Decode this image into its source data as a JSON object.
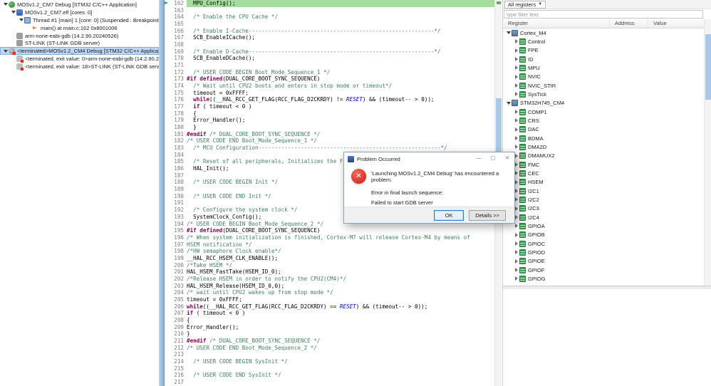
{
  "colors": {
    "debug_current_line_bg": "#a5dd9e",
    "selection_blue": "#bcd8f4",
    "error_red": "#d93025",
    "comment_green": "#3f7f5f",
    "keyword_purple": "#7f0055",
    "enum_blue": "#0000c0",
    "left_strip_blue": "#84abd8",
    "scrollbar_thumb_blue": "#a9c9e8"
  },
  "glyphs": {
    "error": "✕",
    "minimize": "—",
    "maximize": "▢",
    "close": "✕",
    "dropdown": "▼"
  },
  "debug_view": {
    "items": [
      {
        "label": "MOSv1.2_CM7 Debug [STM32 C/C++ Application]",
        "indent": 0,
        "expander": "expanded",
        "icon": "debug-launch-icon",
        "selected": false
      },
      {
        "label": "MOSv1.2_CM7.elf [cores: 0]",
        "indent": 1,
        "expander": "expanded",
        "icon": "executable-icon",
        "selected": false
      },
      {
        "label": "Thread #1 [main] 1 [core: 0] (Suspended : Breakpoint)",
        "indent": 2,
        "expander": "expanded",
        "icon": "thread-icon",
        "selected": false
      },
      {
        "label": "main() at main.c:162 0x8001006",
        "indent": 3,
        "expander": "none",
        "icon": "stack-frame-icon",
        "selected": false
      },
      {
        "label": "arm-none-eabi-gdb (14.2.90.20240526)",
        "indent": 1,
        "expander": "none",
        "icon": "process-icon",
        "selected": false
      },
      {
        "label": "ST-LINK (ST-LINK GDB server)",
        "indent": 1,
        "expander": "none",
        "icon": "process-icon",
        "selected": false
      },
      {
        "label": "<terminated>MOSv1.2_CM4 Debug [STM32 C/C++ Applica",
        "indent": 0,
        "expander": "expanded",
        "icon": "debug-launch-terminated-icon",
        "selected": true
      },
      {
        "label": "<terminated, exit value: 0>arm-none-eabi-gdb (14.2.90.2",
        "indent": 1,
        "expander": "none",
        "icon": "process-terminated-icon",
        "selected": false
      },
      {
        "label": "<terminated, exit value: 18>ST-LINK (ST-LINK GDB server)",
        "indent": 1,
        "expander": "none",
        "icon": "process-terminated-icon",
        "selected": false
      }
    ]
  },
  "editor": {
    "current_line": 162,
    "lines": [
      {
        "n": 162,
        "t": "  MPU_Config();"
      },
      {
        "n": 163,
        "t": ""
      },
      {
        "n": 164,
        "t": "  /* Enable the CPU Cache */"
      },
      {
        "n": 165,
        "t": ""
      },
      {
        "n": 166,
        "t": "  /* Enable I-Cache---------------------------------------------------------*/"
      },
      {
        "n": 167,
        "t": "  SCB_EnableICache();"
      },
      {
        "n": 168,
        "t": ""
      },
      {
        "n": 169,
        "t": "  /* Enable D-Cache---------------------------------------------------------*/"
      },
      {
        "n": 170,
        "t": "  SCB_EnableDCache();"
      },
      {
        "n": 171,
        "t": ""
      },
      {
        "n": 172,
        "t": "  /* USER CODE BEGIN Boot_Mode_Sequence_1 */"
      },
      {
        "n": 173,
        "t": "#if defined(DUAL_CORE_BOOT_SYNC_SEQUENCE)"
      },
      {
        "n": 174,
        "t": "  /* Wait until CPU2 boots and enters in stop mode or timeout*/"
      },
      {
        "n": 175,
        "t": "  timeout = 0xFFFF;"
      },
      {
        "n": 176,
        "t": "  while((__HAL_RCC_GET_FLAG(RCC_FLAG_D2CKRDY) != RESET) && (timeout-- > 0));"
      },
      {
        "n": 177,
        "t": "  if ( timeout < 0 )"
      },
      {
        "n": 178,
        "t": "  {"
      },
      {
        "n": 179,
        "t": "  Error_Handler();"
      },
      {
        "n": 180,
        "t": "  }"
      },
      {
        "n": 181,
        "t": "#endif /* DUAL_CORE_BOOT_SYNC_SEQUENCE */"
      },
      {
        "n": 182,
        "t": "/* USER CODE END Boot_Mode_Sequence_1 */"
      },
      {
        "n": 183,
        "t": "  /* MCU Configuration--------------------------------------------------------*/"
      },
      {
        "n": 184,
        "t": ""
      },
      {
        "n": 185,
        "t": "  /* Reset of all peripherals, Initializes the Flash memory and the Systick. */"
      },
      {
        "n": 186,
        "t": "  HAL_Init();"
      },
      {
        "n": 187,
        "t": ""
      },
      {
        "n": 188,
        "t": "  /* USER CODE BEGIN Init */"
      },
      {
        "n": 189,
        "t": ""
      },
      {
        "n": 190,
        "t": "  /* USER CODE END Init */"
      },
      {
        "n": 191,
        "t": ""
      },
      {
        "n": 192,
        "t": "  /* Configure the system clock */"
      },
      {
        "n": 193,
        "t": "  SystemClock_Config();"
      },
      {
        "n": 194,
        "t": "/* USER CODE BEGIN Boot_Mode_Sequence_2 */"
      },
      {
        "n": 195,
        "t": "#if defined(DUAL_CORE_BOOT_SYNC_SEQUENCE)"
      },
      {
        "n": 196,
        "t": "/* When system initialization is finished, Cortex-M7 will release Cortex-M4 by means of"
      },
      {
        "n": 197,
        "t": "HSEM notification */"
      },
      {
        "n": 198,
        "t": "/*HW semaphore Clock enable*/"
      },
      {
        "n": 199,
        "t": "__HAL_RCC_HSEM_CLK_ENABLE();"
      },
      {
        "n": 200,
        "t": "/*Take HSEM */"
      },
      {
        "n": 201,
        "t": "HAL_HSEM_FastTake(HSEM_ID_0);"
      },
      {
        "n": 202,
        "t": "/*Release HSEM in order to notify the CPU2(CM4)*/"
      },
      {
        "n": 203,
        "t": "HAL_HSEM_Release(HSEM_ID_0,0);"
      },
      {
        "n": 204,
        "t": "/* wait until CPU2 wakes up from stop mode */"
      },
      {
        "n": 205,
        "t": "timeout = 0xFFFF;"
      },
      {
        "n": 206,
        "t": "while((__HAL_RCC_GET_FLAG(RCC_FLAG_D2CKRDY) == RESET) && (timeout-- > 0));"
      },
      {
        "n": 207,
        "t": "if ( timeout < 0 )"
      },
      {
        "n": 208,
        "t": "{"
      },
      {
        "n": 209,
        "t": "Error_Handler();"
      },
      {
        "n": 210,
        "t": "}"
      },
      {
        "n": 211,
        "t": "#endif /* DUAL_CORE_BOOT_SYNC_SEQUENCE */"
      },
      {
        "n": 212,
        "t": "/* USER CODE END Boot_Mode_Sequence_2 */"
      },
      {
        "n": 213,
        "t": ""
      },
      {
        "n": 214,
        "t": "  /* USER CODE BEGIN SysInit */"
      },
      {
        "n": 215,
        "t": ""
      },
      {
        "n": 216,
        "t": "  /* USER CODE END SysInit */"
      },
      {
        "n": 217,
        "t": ""
      }
    ]
  },
  "registers_view": {
    "scope_selector": "All registers",
    "filter_placeholder": "type filter text",
    "columns": [
      "Register",
      "Address",
      "Value"
    ],
    "items": [
      {
        "label": "Cortex_M4",
        "level": 0,
        "expander": "expanded",
        "icon": "mcu-group-icon"
      },
      {
        "label": "Control",
        "level": 1,
        "expander": "collapsed",
        "icon": "register-group-icon"
      },
      {
        "label": "FPE",
        "level": 1,
        "expander": "collapsed",
        "icon": "register-group-icon"
      },
      {
        "label": "ID",
        "level": 1,
        "expander": "collapsed",
        "icon": "register-group-icon"
      },
      {
        "label": "MPU",
        "level": 1,
        "expander": "collapsed",
        "icon": "register-group-icon"
      },
      {
        "label": "NVIC",
        "level": 1,
        "expander": "collapsed",
        "icon": "register-group-icon"
      },
      {
        "label": "NVIC_STIR",
        "level": 1,
        "expander": "collapsed",
        "icon": "register-group-icon"
      },
      {
        "label": "SysTick",
        "level": 1,
        "expander": "collapsed",
        "icon": "register-group-icon"
      },
      {
        "label": "STM32H745_CM4",
        "level": 0,
        "expander": "expanded",
        "icon": "mcu-group-icon"
      },
      {
        "label": "COMP1",
        "level": 1,
        "expander": "collapsed",
        "icon": "register-group-icon"
      },
      {
        "label": "CRS",
        "level": 1,
        "expander": "collapsed",
        "icon": "register-group-icon"
      },
      {
        "label": "DAC",
        "level": 1,
        "expander": "collapsed",
        "icon": "register-group-icon"
      },
      {
        "label": "BDMA",
        "level": 1,
        "expander": "collapsed",
        "icon": "register-group-icon"
      },
      {
        "label": "DMA2D",
        "level": 1,
        "expander": "collapsed",
        "icon": "register-group-icon"
      },
      {
        "label": "DMAMUX2",
        "level": 1,
        "expander": "collapsed",
        "icon": "register-group-icon"
      },
      {
        "label": "FMC",
        "level": 1,
        "expander": "collapsed",
        "icon": "register-group-icon"
      },
      {
        "label": "CEC",
        "level": 1,
        "expander": "collapsed",
        "icon": "register-group-icon"
      },
      {
        "label": "HSEM",
        "level": 1,
        "expander": "collapsed",
        "icon": "register-group-icon"
      },
      {
        "label": "I2C1",
        "level": 1,
        "expander": "collapsed",
        "icon": "register-group-icon"
      },
      {
        "label": "I2C2",
        "level": 1,
        "expander": "collapsed",
        "icon": "register-group-icon"
      },
      {
        "label": "I2C3",
        "level": 1,
        "expander": "collapsed",
        "icon": "register-group-icon"
      },
      {
        "label": "I2C4",
        "level": 1,
        "expander": "collapsed",
        "icon": "register-group-icon"
      },
      {
        "label": "GPIOA",
        "level": 1,
        "expander": "collapsed",
        "icon": "register-group-icon"
      },
      {
        "label": "GPIOB",
        "level": 1,
        "expander": "collapsed",
        "icon": "register-group-icon"
      },
      {
        "label": "GPIOC",
        "level": 1,
        "expander": "collapsed",
        "icon": "register-group-icon"
      },
      {
        "label": "GPIOD",
        "level": 1,
        "expander": "collapsed",
        "icon": "register-group-icon"
      },
      {
        "label": "GPIOE",
        "level": 1,
        "expander": "collapsed",
        "icon": "register-group-icon"
      },
      {
        "label": "GPIOF",
        "level": 1,
        "expander": "collapsed",
        "icon": "register-group-icon"
      },
      {
        "label": "GPIOG",
        "level": 1,
        "expander": "collapsed",
        "icon": "register-group-icon"
      }
    ]
  },
  "dialog": {
    "title": "Problem Occurred",
    "message": "'Launching MOSv1.2_CM4 Debug' has encountered a problem.",
    "detail_lines": [
      "Error in final launch sequence:",
      "Failed to start GDB server"
    ],
    "buttons": {
      "ok": "OK",
      "details": "Details >>"
    }
  }
}
